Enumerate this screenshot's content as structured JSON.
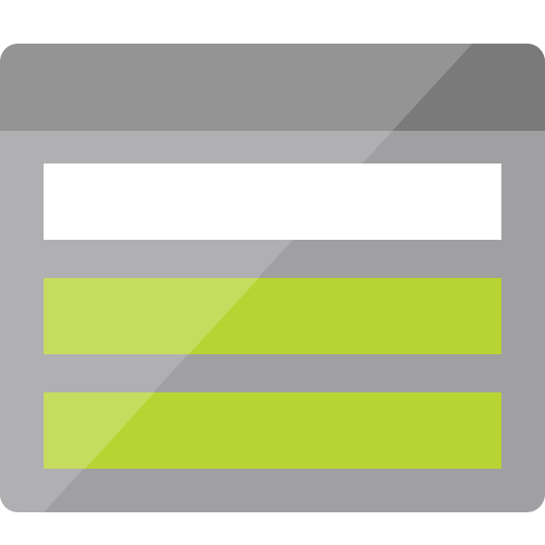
{
  "icon": {
    "semantic_name": "storage-table-icon",
    "colors": {
      "background": "#ffffff",
      "header_bar": "#949494",
      "header_bar_dark": "#7a7a7a",
      "body": "#a0a0a2",
      "body_highlight": "#b0b0b3",
      "row_1": "#ffffff",
      "row_2": "#b8d432",
      "row_3": "#b8d432",
      "row_highlight": "#c5dc5e"
    },
    "rows": [
      {
        "fill": "white"
      },
      {
        "fill": "green"
      },
      {
        "fill": "green"
      }
    ]
  }
}
